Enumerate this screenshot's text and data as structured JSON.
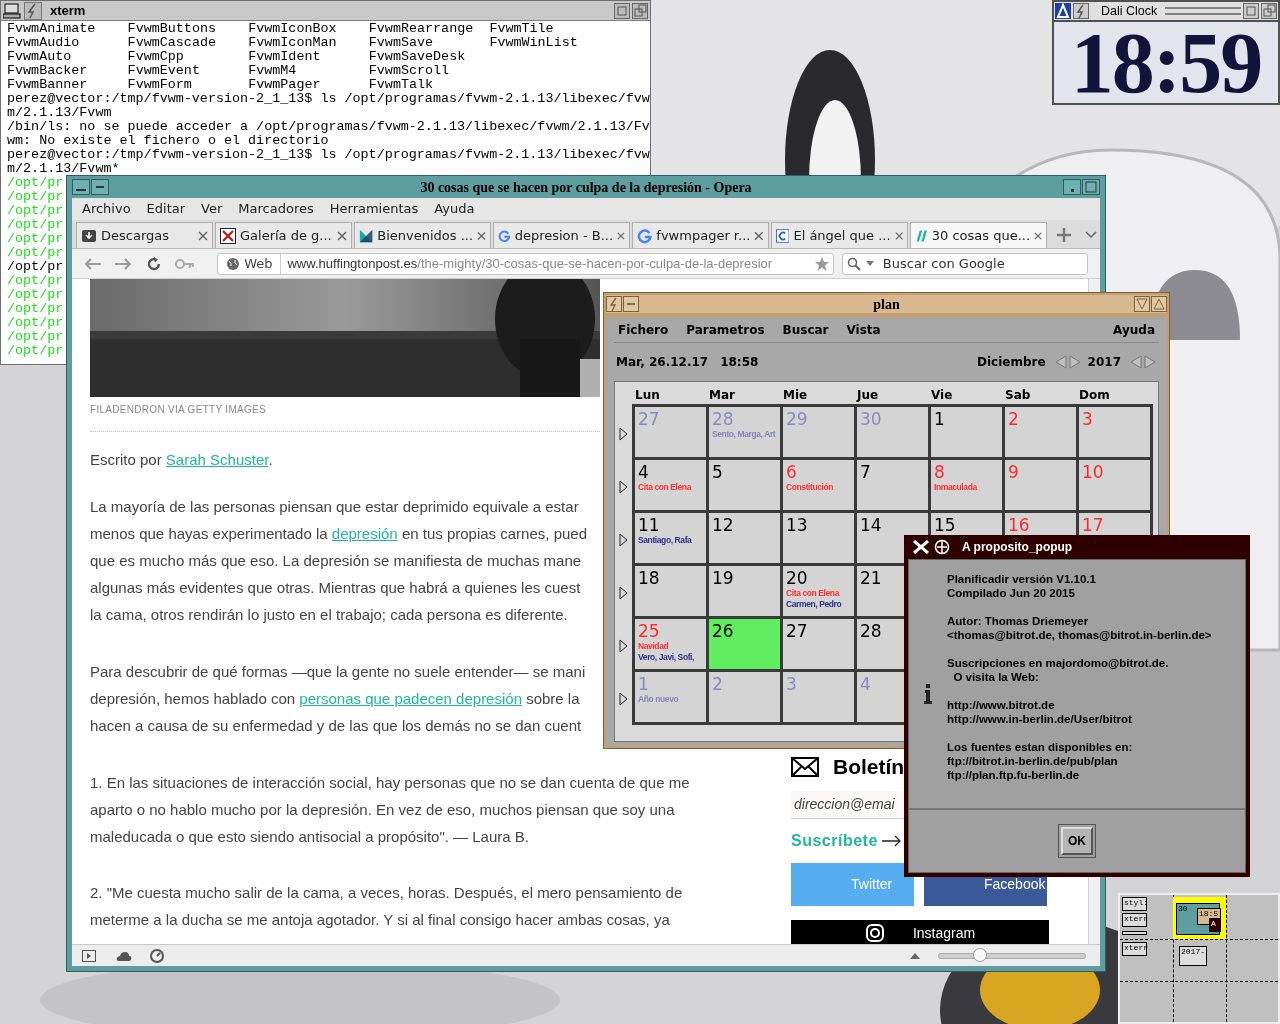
{
  "xterm": {
    "title": "xterm",
    "listing": [
      [
        "FvwmAnimate",
        "FvwmButtons",
        "FvwmIconBox",
        "FvwmRearrange",
        "FvwmTile"
      ],
      [
        "FvwmAudio",
        "FvwmCascade",
        "FvwmIconMan",
        "FvwmSave",
        "FvwmWinList"
      ],
      [
        "FvwmAuto",
        "FvwmCpp",
        "FvwmIdent",
        "FvwmSaveDesk"
      ],
      [
        "FvwmBacker",
        "FvwmEvent",
        "FvwmM4",
        "FvwmScroll"
      ],
      [
        "FvwmBanner",
        "FvwmForm",
        "FvwmPager",
        "FvwmTalk"
      ]
    ],
    "output": [
      {
        "text": "perez@vector:/tmp/fvwm-version-2_1_13$ ls /opt/programas/fvwm-2.1.13/libexec/fvw",
        "color": "#000000"
      },
      {
        "text": "m/2.1.13/Fvwm",
        "color": "#000000"
      },
      {
        "text": "/bin/ls: no se puede acceder a /opt/programas/fvwm-2.1.13/libexec/fvwm/2.1.13/Fv",
        "color": "#000000"
      },
      {
        "text": "wm: No existe el fichero o el directorio",
        "color": "#000000"
      },
      {
        "text": "perez@vector:/tmp/fvwm-version-2_1_13$ ls /opt/programas/fvwm-2.1.13/libexec/fvw",
        "color": "#000000"
      },
      {
        "text": "m/2.1.13/Fvwm*",
        "color": "#000000"
      },
      {
        "text": "/opt/pr",
        "color": "#22dd22"
      },
      {
        "text": "/opt/pr",
        "color": "#22dd22"
      },
      {
        "text": "/opt/pr",
        "color": "#22dd22"
      },
      {
        "text": "/opt/pr",
        "color": "#22dd22"
      },
      {
        "text": "/opt/pr",
        "color": "#22dd22"
      },
      {
        "text": "/opt/pr",
        "color": "#22dd22"
      },
      {
        "text": "/opt/pr",
        "color": "#000000"
      },
      {
        "text": "/opt/pr",
        "color": "#22dd22"
      },
      {
        "text": "/opt/pr",
        "color": "#22dd22"
      },
      {
        "text": "/opt/pr",
        "color": "#22dd22"
      },
      {
        "text": "/opt/pr",
        "color": "#22dd22"
      },
      {
        "text": "/opt/pr",
        "color": "#22dd22"
      },
      {
        "text": "/opt/pr",
        "color": "#22dd22"
      }
    ]
  },
  "clock": {
    "title": "Dali Clock",
    "time": "18:59"
  },
  "browser": {
    "title": "30 cosas que se hacen por culpa de la depresión - Opera",
    "menu": [
      "Archivo",
      "Editar",
      "Ver",
      "Marcadores",
      "Herramientas",
      "Ayuda"
    ],
    "tabs": [
      {
        "label": "Descargas",
        "selected": false
      },
      {
        "label": "Galería de g...",
        "selected": false
      },
      {
        "label": "Bienvenidos ...",
        "selected": false
      },
      {
        "label": "depresion - B...",
        "selected": false
      },
      {
        "label": "fvwmpager r...",
        "selected": false
      },
      {
        "label": "El ángel que ...",
        "selected": false
      },
      {
        "label": "30 cosas que...",
        "selected": true
      }
    ],
    "address": {
      "badge": "Web",
      "host": "www.huffingtonpost.es",
      "path": "/the-mighty/30-cosas-que-se-hacen-por-culpa-de-la-depresior"
    },
    "search": {
      "placeholder": "Buscar con Google"
    },
    "article": {
      "caption": "FILADENDRON VIA GETTY IMAGES",
      "paragraphs": [
        [
          [
            {
              "text": "Escrito por ",
              "link": false
            },
            {
              "text": "Sarah Schuster",
              "link": true
            },
            {
              "text": ".",
              "link": false
            }
          ]
        ],
        [
          [
            {
              "text": "La mayoría de las personas piensan que estar deprimido equivale a estar",
              "link": false
            }
          ],
          [
            {
              "text": "menos que hayas experimentado la ",
              "link": false
            },
            {
              "text": "depresión",
              "link": true
            },
            {
              "text": " en tus propias carnes, pued",
              "link": false
            }
          ],
          [
            {
              "text": "que es mucho más que eso. La depresión se manifiesta de muchas mane",
              "link": false
            }
          ],
          [
            {
              "text": "algunas más evidentes que otras. Mientras que habrá a quienes les cuest",
              "link": false
            }
          ],
          [
            {
              "text": "la cama, otros rendirán lo justo en el trabajo; cada persona es diferente.",
              "link": false
            }
          ]
        ],
        [
          [
            {
              "text": "Para descubrir de qué formas —que la gente no suele entender— se mani",
              "link": false
            }
          ],
          [
            {
              "text": "depresión, hemos hablado con ",
              "link": false
            },
            {
              "text": "personas que padecen depresión",
              "link": true
            },
            {
              "text": " sobre la",
              "link": false
            }
          ],
          [
            {
              "text": "hacen a causa de su enfermedad y de las que los demás no se dan cuent",
              "link": false
            }
          ]
        ],
        [
          [
            {
              "text": "1. En las situaciones de interacción social, hay personas que no se dan cuenta de que me",
              "link": false
            }
          ],
          [
            {
              "text": "aparto o no hablo mucho por la depresión. En vez de eso, muchos piensan que soy una",
              "link": false
            }
          ],
          [
            {
              "text": "maleducada o que esto siendo antisocial a propósito\". — Laura B.",
              "link": false
            }
          ]
        ],
        [
          [
            {
              "text": "2. \"Me cuesta mucho salir de la cama, a veces, horas. Después, el mero pensamiento de",
              "link": false
            }
          ],
          [
            {
              "text": "meterme a la ducha se me antoja agotador. Y si al final consigo hacer ambas cosas, ya",
              "link": false
            }
          ]
        ]
      ]
    },
    "sidebar": {
      "newsletter": "Boletín",
      "email_placeholder": "direccion@emai",
      "subscribe": "Suscríbete",
      "share": [
        {
          "label": "Twitter",
          "color": "#55acee"
        },
        {
          "label": "Facebook",
          "color": "#3b5998"
        },
        {
          "label": "Instagram",
          "color": "#000000"
        }
      ]
    },
    "zoom": {
      "level": 0.28
    }
  },
  "plan": {
    "title": "plan",
    "menu": [
      "Fichero",
      "Parametros",
      "Buscar",
      "Vista"
    ],
    "help": "Ayuda",
    "date": "Mar, 26.12.17",
    "time": "18:58",
    "month": "Diciembre",
    "year": "2017",
    "weekdays": [
      "Lun",
      "Mar",
      "Mie",
      "Jue",
      "Vie",
      "Sab",
      "Dom"
    ],
    "weeks": [
      [
        {
          "day": "27",
          "kind": "other"
        },
        {
          "day": "28",
          "kind": "other",
          "events": [
            {
              "text": "Sento, Marga, Art",
              "color": "#8484bc"
            }
          ]
        },
        {
          "day": "29",
          "kind": "other"
        },
        {
          "day": "30",
          "kind": "other"
        },
        {
          "day": "1",
          "kind": "normal"
        },
        {
          "day": "2",
          "kind": "holiday"
        },
        {
          "day": "3",
          "kind": "holiday"
        }
      ],
      [
        {
          "day": "4",
          "kind": "normal",
          "events": [
            {
              "text": "Cita con Elena",
              "color": "#ff3030"
            }
          ]
        },
        {
          "day": "5",
          "kind": "normal"
        },
        {
          "day": "6",
          "kind": "holiday",
          "events": [
            {
              "text": "Constitución",
              "color": "#ff3030"
            }
          ]
        },
        {
          "day": "7",
          "kind": "normal"
        },
        {
          "day": "8",
          "kind": "holiday",
          "events": [
            {
              "text": "Inmaculada",
              "color": "#ff3030"
            }
          ]
        },
        {
          "day": "9",
          "kind": "holiday"
        },
        {
          "day": "10",
          "kind": "holiday"
        }
      ],
      [
        {
          "day": "11",
          "kind": "normal",
          "events": [
            {
              "text": "Santiago, Rafa",
              "color": "#303088"
            }
          ]
        },
        {
          "day": "12",
          "kind": "normal"
        },
        {
          "day": "13",
          "kind": "normal"
        },
        {
          "day": "14",
          "kind": "normal"
        },
        {
          "day": "15",
          "kind": "normal"
        },
        {
          "day": "16",
          "kind": "holiday"
        },
        {
          "day": "17",
          "kind": "holiday"
        }
      ],
      [
        {
          "day": "18",
          "kind": "normal"
        },
        {
          "day": "19",
          "kind": "normal"
        },
        {
          "day": "20",
          "kind": "normal",
          "events": [
            {
              "text": "Cita con Elena",
              "color": "#ff3030"
            },
            {
              "text": "Carmen, Pedro",
              "color": "#303088"
            }
          ]
        },
        {
          "day": "21",
          "kind": "normal"
        }
      ],
      [
        {
          "day": "25",
          "kind": "holiday",
          "events": [
            {
              "text": "Navidad",
              "color": "#ff3030"
            },
            {
              "text": "Vero, Javi, Sofi,",
              "color": "#303088"
            }
          ]
        },
        {
          "day": "26",
          "kind": "today"
        },
        {
          "day": "27",
          "kind": "normal"
        },
        {
          "day": "28",
          "kind": "normal"
        }
      ],
      [
        {
          "day": "1",
          "kind": "other",
          "events": [
            {
              "text": "Año nuevo",
              "color": "#8484bc"
            }
          ]
        },
        {
          "day": "2",
          "kind": "other"
        },
        {
          "day": "3",
          "kind": "other"
        },
        {
          "day": "4",
          "kind": "other"
        }
      ]
    ]
  },
  "about": {
    "title": "A proposito_popup",
    "blocks": [
      [
        "Planificadir versión V1.10.1",
        "Compilado Jun 20 2015"
      ],
      [
        "Autor: Thomas Driemeyer",
        "<thomas@bitrot.de, thomas@bitrot.in-berlin.de>"
      ],
      [
        "Suscripciones en majordomo@bitrot.de.",
        "  O visita la Web:"
      ],
      [
        "http://www.bitrot.de",
        "http://www.in-berlin.de/User/bitrot"
      ],
      [
        "Los fuentes estan disponibles en:",
        "ftp://bitrot.in-berlin.de/pub/plan",
        "ftp://plan.ftp.fu-berlin.de"
      ]
    ],
    "ok": "OK"
  },
  "pager": {
    "windows": [
      {
        "label": "styl:"
      },
      {
        "label": "xterr"
      },
      {
        "label": "xterr"
      },
      {
        "label": "30"
      },
      {
        "label": "18:5"
      },
      {
        "label": "A"
      },
      {
        "label": "2017-"
      }
    ]
  }
}
